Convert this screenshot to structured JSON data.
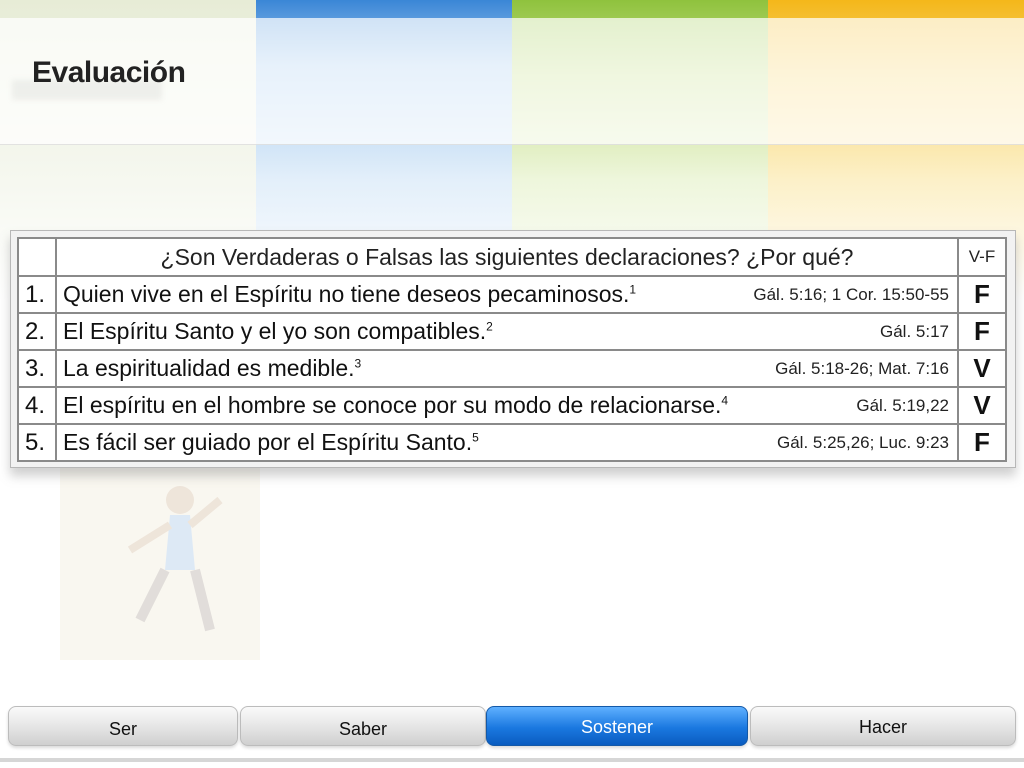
{
  "slide": {
    "title": "Evaluación"
  },
  "table": {
    "header": {
      "question": "¿Son Verdaderas o Falsas las siguientes declaraciones? ¿Por qué?",
      "vf": "V-F"
    },
    "rows": [
      {
        "num": "1.",
        "text": "Quien vive en el Espíritu no tiene deseos pecaminosos.",
        "sup": "1",
        "ref": "Gál. 5:16; 1 Cor. 15:50-55",
        "answer": "F"
      },
      {
        "num": "2.",
        "text": "El Espíritu Santo y el yo son compatibles.",
        "sup": "2",
        "ref": "Gál. 5:17",
        "answer": "F"
      },
      {
        "num": "3.",
        "text": "La espiritualidad es medible.",
        "sup": "3",
        "ref": "Gál. 5:18-26; Mat. 7:16",
        "answer": "V"
      },
      {
        "num": "4.",
        "text": "El espíritu en el hombre se conoce por su modo de relacionarse.",
        "sup": "4",
        "ref": "Gál. 5:19,22",
        "answer": "V"
      },
      {
        "num": "5.",
        "text": "Es fácil ser guiado por el Espíritu Santo.",
        "sup": "5",
        "ref": "Gál. 5:25,26; Luc. 9:23",
        "answer": "F"
      }
    ]
  },
  "nav": {
    "tabs": [
      "Ser",
      "Saber",
      "Sostener",
      "Hacer"
    ],
    "active": "Sostener"
  },
  "colors": {
    "blue": "#3a86d6",
    "green": "#8fc23d",
    "yellow": "#f4b71a",
    "active_tab": "#1a78e0"
  }
}
